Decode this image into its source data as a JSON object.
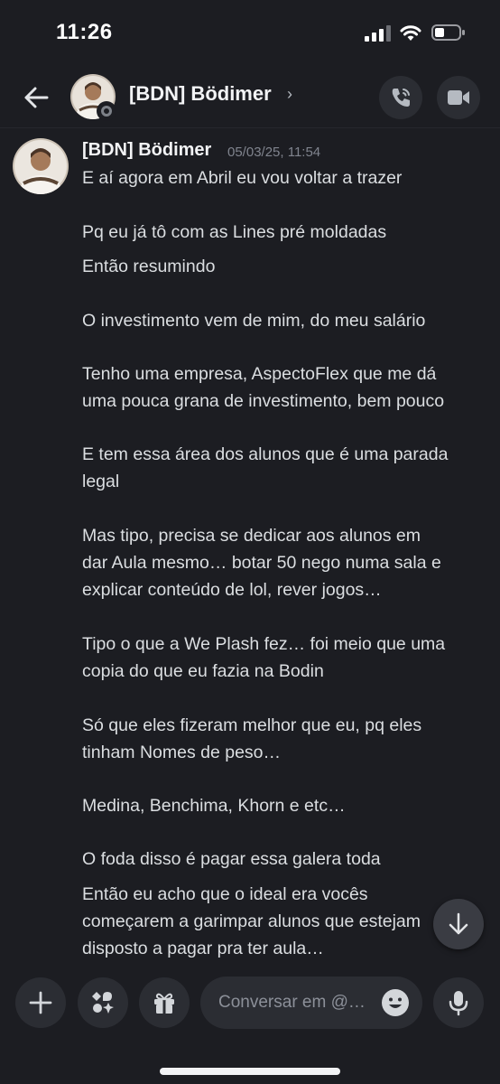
{
  "status_bar": {
    "time": "11:26"
  },
  "header": {
    "title": "[BDN] Bödimer",
    "chevron": "›"
  },
  "message": {
    "author": "[BDN] Bödimer",
    "timestamp": "05/03/25, 11:54",
    "lines": [
      "E aí agora em Abril eu vou voltar a trazer",
      "Pq eu já tô com as Lines pré moldadas",
      "Então resumindo",
      "O investimento vem de mim, do meu salário",
      "Tenho uma empresa, AspectoFlex que me dá",
      "uma pouca grana de investimento, bem pouco",
      "E tem essa área dos alunos que é uma parada",
      "legal",
      "Mas tipo, precisa se dedicar aos alunos em",
      "dar Aula mesmo… botar 50 nego numa sala e",
      "explicar conteúdo de lol, rever jogos…",
      "Tipo o que a We Plash fez… foi meio que uma",
      "copia do que eu fazia na Bodin",
      "Só que eles fizeram melhor que eu, pq eles",
      "tinham Nomes de peso…",
      "Medina, Benchima, Khorn e etc…",
      "O foda disso é pagar essa galera toda",
      "Então eu acho que o ideal era vocês",
      "começarem a garimpar alunos que estejam",
      "disposto a pagar pra ter aula…"
    ]
  },
  "composer": {
    "placeholder": "Conversar em @…"
  },
  "colors": {
    "background": "#1c1d22",
    "button": "#2b2d33",
    "text": "#dbdee1",
    "muted": "#80848e"
  }
}
